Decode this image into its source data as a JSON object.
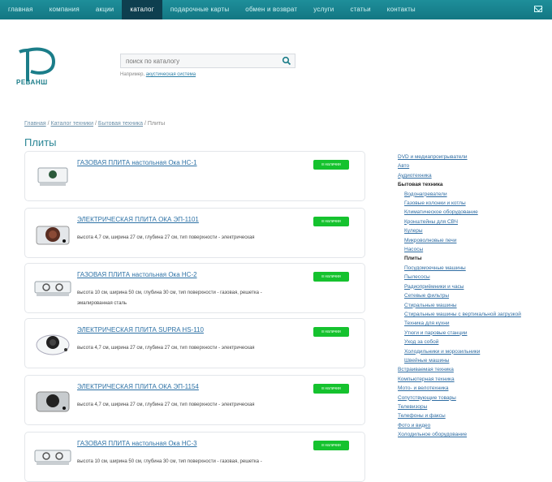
{
  "nav": {
    "items": [
      "главная",
      "компания",
      "акции",
      "каталог",
      "подарочные карты",
      "обмен и возврат",
      "услуги",
      "статьи",
      "контакты"
    ],
    "active_index": 3
  },
  "logo": {
    "text": "РЕВАНШ"
  },
  "search": {
    "placeholder": "поиск по каталогу",
    "hint_prefix": "Например,",
    "hint_link": "акустическая система"
  },
  "breadcrumb": {
    "items": [
      "Главная",
      "Каталог техники",
      "Бытовая техника",
      "Плиты"
    ]
  },
  "page_title": "Плиты",
  "products": [
    {
      "title": "ГАЗОВАЯ ПЛИТА настольная Ока НС-1",
      "desc": "",
      "badge": "в наличии"
    },
    {
      "title": "ЭЛЕКТРИЧЕСКАЯ ПЛИТА ОКА ЭП-1101",
      "desc": "высота 4,7 см, ширина 27 см, глубина 27 см, тип поверхности - электрическая",
      "badge": "в наличии"
    },
    {
      "title": "ГАЗОВАЯ ПЛИТА настольная Ока НС-2",
      "desc": "высота 10 см, ширина 50 см, глубина 30 см, тип поверхности - газовая, решетка - эмалированная сталь",
      "badge": "в наличии"
    },
    {
      "title": "ЭЛЕКТРИЧЕСКАЯ ПЛИТА SUPRA HS-110",
      "desc": "высота 4,7 см, ширина 27 см, глубина 27 см, тип поверхности - электрическая",
      "badge": "в наличии"
    },
    {
      "title": "ЭЛЕКТРИЧЕСКАЯ ПЛИТА ОКА ЭП-1154",
      "desc": "высота 4,7 см, ширина 27 см, глубина 27 см, тип поверхности - электрическая",
      "badge": "в наличии"
    },
    {
      "title": "ГАЗОВАЯ ПЛИТА настольная Ока НС-3",
      "desc": "высота 10 см, ширина 50 см, глубина 30 см, тип поверхности - газовая, решетка -",
      "badge": "в наличии"
    }
  ],
  "sidebar": {
    "top": [
      "DVD и медиапроигрыватели",
      "Авто",
      "Аудиотехника"
    ],
    "current_section": "Бытовая техника",
    "sub": [
      "Водонагреватели",
      "Газовые колонки и котлы",
      "Климатическое оборудование",
      "Кронштейны для СВЧ",
      "Кулеры",
      "Микроволновые печи",
      "Насосы",
      "Плиты",
      "Посудомоечные машины",
      "Пылесосы",
      "Радиоприёмники и часы",
      "Сетевые фильтры",
      "Стиральные машины",
      "Стиральные машины с вертикальной загрузкой",
      "Техника для кухни",
      "Утюги и паровые станции",
      "Уход за собой",
      "Холодильники и морозильники",
      "Швейные машины"
    ],
    "current_sub": "Плиты",
    "bottom": [
      "Встраиваемая техника",
      "Компьютерная техника",
      "Мото- и велотехника",
      "Сопутствующие товары",
      "Телевизоры",
      "Телефоны и факсы",
      "Фото и видео",
      "Холодильное оборудование"
    ]
  },
  "colors": {
    "nav_bg": "#1a8793",
    "nav_active": "#0e3f4f",
    "title": "#2c8796",
    "link": "#2e72a6",
    "badge": "#15c22e"
  }
}
